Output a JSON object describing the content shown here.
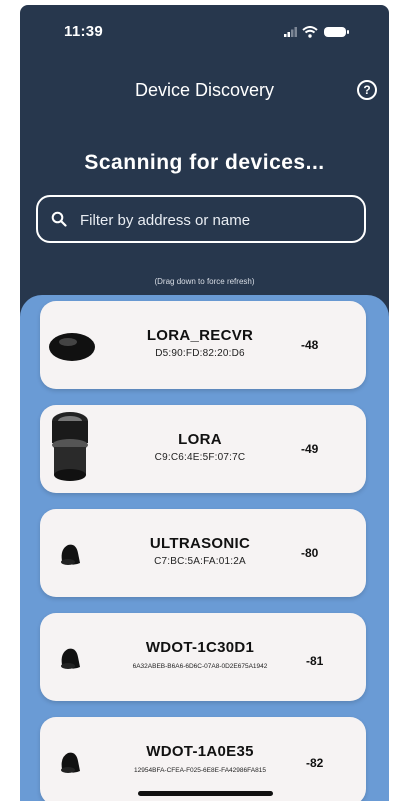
{
  "status_bar": {
    "time": "11:39"
  },
  "header": {
    "title": "Device Discovery"
  },
  "scanning_text": "Scanning for devices...",
  "search": {
    "placeholder": "Filter by address or name"
  },
  "refresh_hint": "(Drag down to force refresh)",
  "devices": [
    {
      "name": "LORA_RECVR",
      "address": "D5:90:FD:82:20:D6",
      "rssi": "-48",
      "icon": "round-puck-icon"
    },
    {
      "name": "LORA",
      "address": "C9:C6:4E:5F:07:7C",
      "rssi": "-49",
      "icon": "cylinder-speaker-icon"
    },
    {
      "name": "ULTRASONIC",
      "address": "C7:BC:5A:FA:01:2A",
      "rssi": "-80",
      "icon": "sensor-device-icon"
    },
    {
      "name": "WDOT-1C30D1",
      "address": "6A32ABEB-B6A6-6D6C-07A8-0D2E675A1942",
      "rssi": "-81",
      "icon": "sensor-device-icon"
    },
    {
      "name": "WDOT-1A0E35",
      "address": "12954BFA-CFEA-F025-6E8E-FA42986FA815",
      "rssi": "-82",
      "icon": "sensor-device-icon"
    }
  ]
}
